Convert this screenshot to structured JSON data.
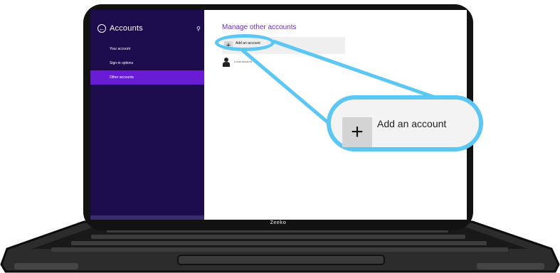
{
  "sidebar": {
    "title": "Accounts",
    "back_icon": "back-arrow-icon",
    "search_icon": "search-icon",
    "items": [
      {
        "label": "Your account"
      },
      {
        "label": "Sign-in options"
      },
      {
        "label": "Other accounts",
        "active": true
      }
    ]
  },
  "main": {
    "title": "Manage other accounts",
    "add_account_label": "Add an account",
    "account_type": "Local Account"
  },
  "callout": {
    "label": "Add an account"
  },
  "laptop": {
    "brand": "Zeeko"
  },
  "colors": {
    "sidebar_bg": "#1c0b4d",
    "active_item": "#6a1bd6",
    "accent_text": "#6a2dc8",
    "highlight": "#5bc7f2"
  }
}
